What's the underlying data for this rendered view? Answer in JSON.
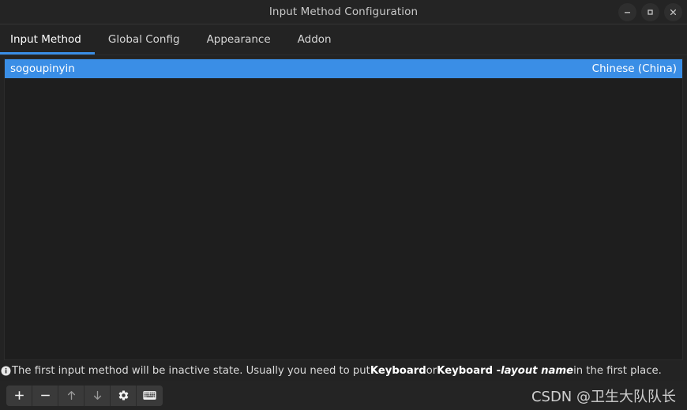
{
  "window": {
    "title": "Input Method Configuration",
    "controls": [
      {
        "name": "minimize-button",
        "glyph": "minimize-icon"
      },
      {
        "name": "maximize-button",
        "glyph": "maximize-icon"
      },
      {
        "name": "close-button",
        "glyph": "close-icon"
      }
    ]
  },
  "tabs": [
    {
      "label": "Input Method",
      "active": true
    },
    {
      "label": "Global Config",
      "active": false
    },
    {
      "label": "Appearance",
      "active": false
    },
    {
      "label": "Addon",
      "active": false
    }
  ],
  "list": {
    "rows": [
      {
        "name": "sogoupinyin",
        "language": "Chinese (China)",
        "selected": true
      }
    ]
  },
  "hint": {
    "icon": "info-icon",
    "part1": "The first input method will be inactive state. Usually you need to put ",
    "bold1": "Keyboard",
    "part2": " or ",
    "bold2": "Keyboard - ",
    "italic1": "layout name",
    "part3": " in the first place."
  },
  "toolbar": {
    "buttons": [
      {
        "name": "add-button",
        "icon": "plus-icon",
        "dim": false
      },
      {
        "name": "remove-button",
        "icon": "minus-icon",
        "dim": false
      },
      {
        "name": "move-up-button",
        "icon": "arrow-up-icon",
        "dim": true
      },
      {
        "name": "move-down-button",
        "icon": "arrow-down-icon",
        "dim": true
      },
      {
        "name": "configure-button",
        "icon": "gear-icon",
        "dim": false
      },
      {
        "name": "keyboard-layout-button",
        "icon": "keyboard-icon",
        "dim": false
      }
    ]
  },
  "watermark": {
    "text": "CSDN @卫生大队队长"
  },
  "colors": {
    "accent": "#3a8ee6",
    "window_bg": "#232323",
    "list_bg": "#1e1e1e",
    "titlebar_bg": "#242424",
    "toolbar_button_bg": "#3a3a3a"
  }
}
